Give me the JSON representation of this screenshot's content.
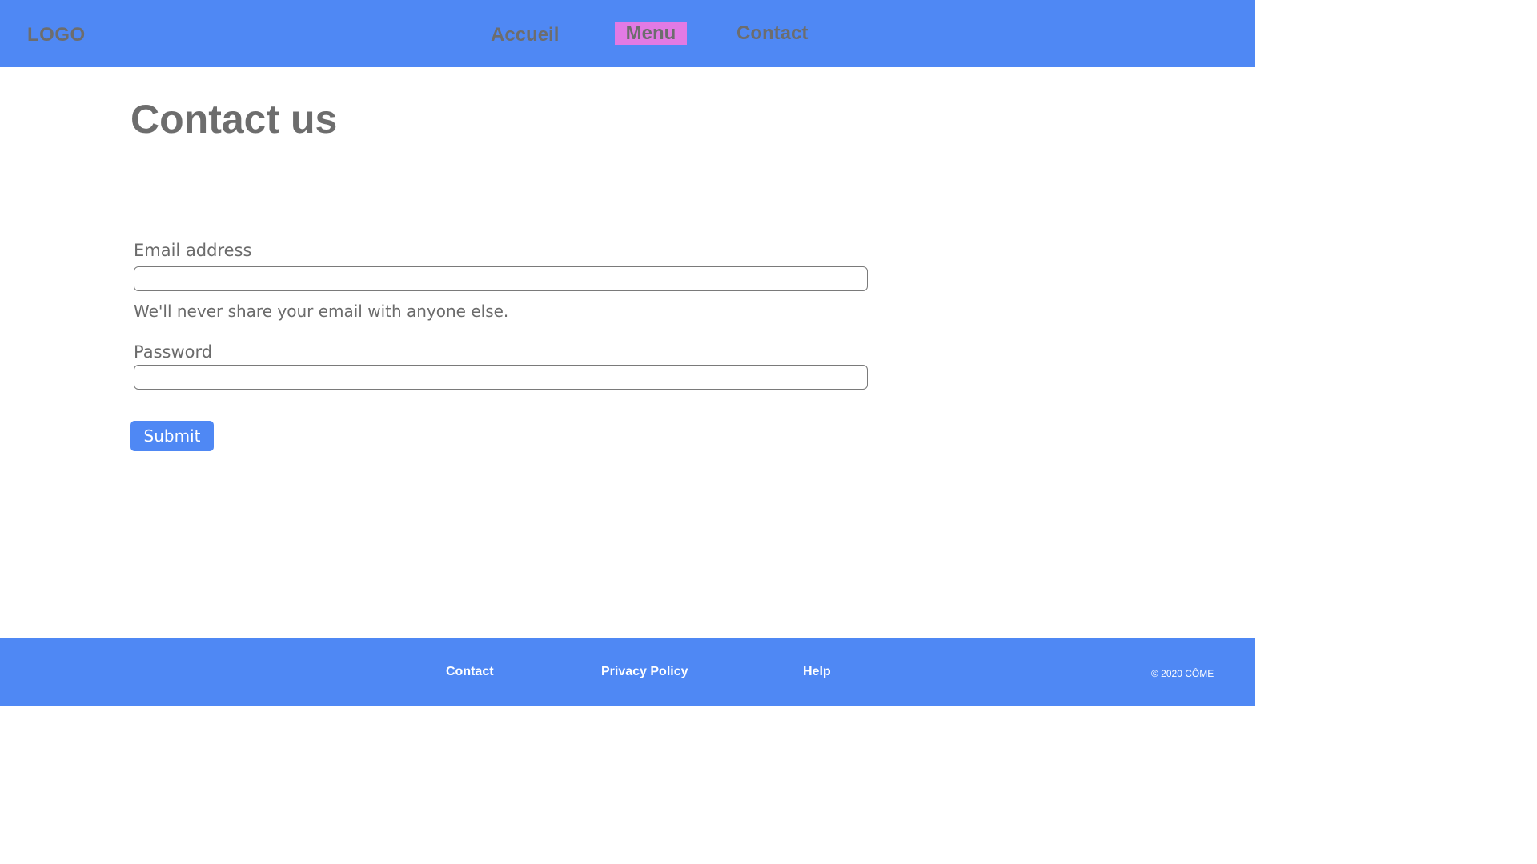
{
  "header": {
    "logo": "LOGO",
    "nav": {
      "accueil": "Accueil",
      "menu": "Menu",
      "contact": "Contact"
    }
  },
  "main": {
    "title": "Contact us",
    "form": {
      "email_label": "Email address",
      "email_value": "",
      "email_help": "We'll never share your email with anyone else.",
      "password_label": "Password",
      "password_value": "",
      "submit_label": "Submit"
    }
  },
  "footer": {
    "links": {
      "contact": "Contact",
      "privacy": "Privacy Policy",
      "help": "Help"
    },
    "copyright": "© 2020 CÔME"
  },
  "colors": {
    "brand_blue": "#4f88f4",
    "active_nav": "#e27ae4",
    "text_gray": "#6d6d6d"
  }
}
